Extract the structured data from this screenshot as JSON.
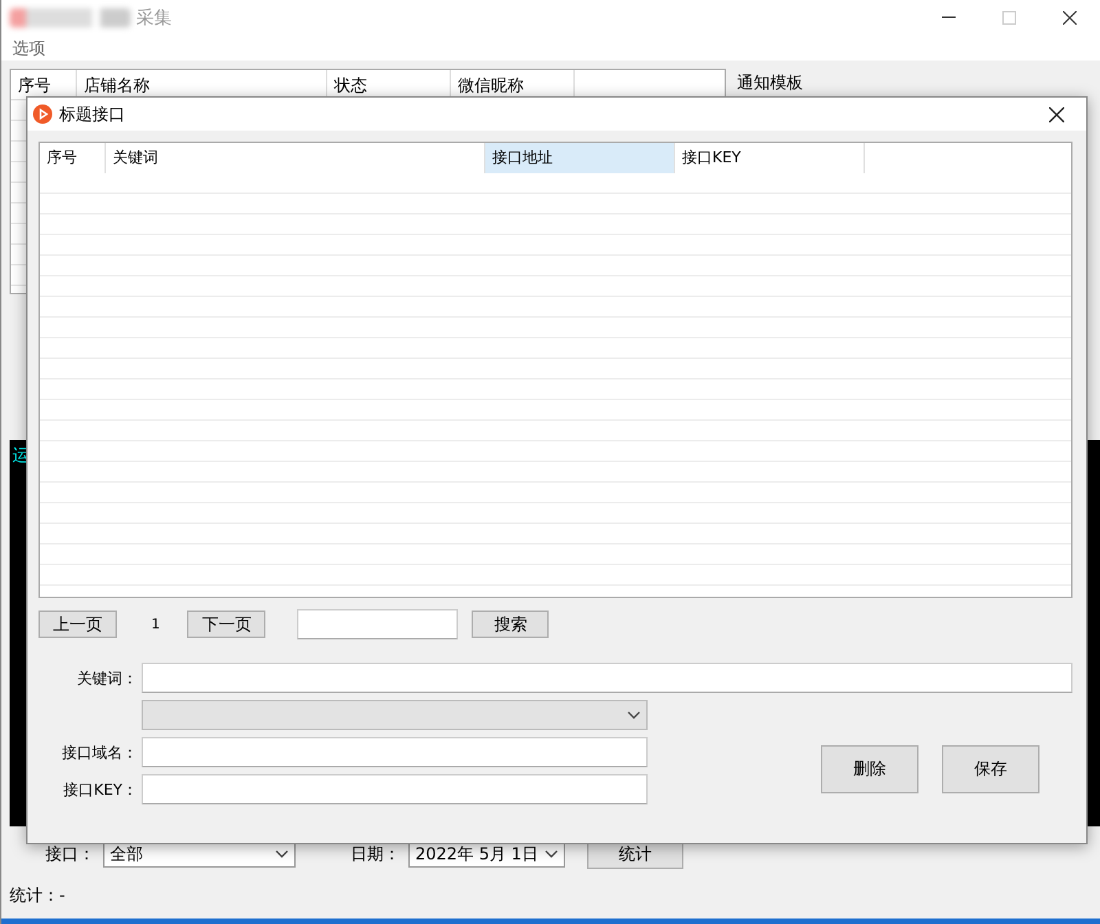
{
  "window": {
    "title": "采集",
    "menu": [
      "选项"
    ]
  },
  "main_table": {
    "columns": [
      "序号",
      "店铺名称",
      "状态",
      "微信昵称"
    ]
  },
  "notice_panel": {
    "title": "通知模板"
  },
  "console": {
    "lines": [
      "运"
    ]
  },
  "filter": {
    "interface_label": "接口：",
    "interface_value": "全部",
    "date_label": "日期：",
    "date_value": "2022年  5月  1日",
    "button": "统计"
  },
  "summary": "统计：-",
  "dialog": {
    "title": "标题接口",
    "table": {
      "columns": [
        {
          "label": "序号",
          "selected": false
        },
        {
          "label": "关键词",
          "selected": false
        },
        {
          "label": "接口地址",
          "selected": true
        },
        {
          "label": "接口KEY",
          "selected": false
        }
      ]
    },
    "pager": {
      "prev": "上一页",
      "page": "1",
      "next": "下一页",
      "search": "搜索"
    },
    "form": [
      {
        "kind": "text",
        "label": "关键词："
      },
      {
        "kind": "select"
      },
      {
        "kind": "text",
        "label": "接口域名："
      },
      {
        "kind": "text",
        "label": "接口KEY："
      }
    ],
    "buttons": [
      "删除",
      "保存"
    ]
  }
}
